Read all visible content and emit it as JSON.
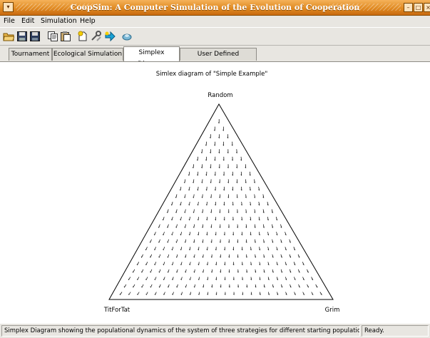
{
  "window": {
    "title": "CoopSim: A Computer Simulation of the Evolution of Cooperation",
    "accent": "#e08a22"
  },
  "menu": [
    "File",
    "Edit",
    "Simulation",
    "Help"
  ],
  "toolbar": {
    "icons": [
      "open-icon",
      "save-icon",
      "save-as-icon",
      "copy-icon",
      "paste-icon",
      "new-icon",
      "tools-icon",
      "run-icon",
      "stop-icon"
    ]
  },
  "tabs": [
    {
      "label": "Tournament"
    },
    {
      "label": "Ecological Simulation"
    },
    {
      "label": "Simplex Diagram",
      "active": true
    },
    {
      "label": "User Defined Strategies"
    }
  ],
  "diagram": {
    "title": "Simlex diagram of \"Simple Example\"",
    "vertices": {
      "top": "Random",
      "left": "TitForTat",
      "right": "Grim"
    }
  },
  "status": {
    "message": "Simplex Diagram showing the populational dynamics of the system of three strategies for different starting populations.",
    "state": "Ready."
  }
}
